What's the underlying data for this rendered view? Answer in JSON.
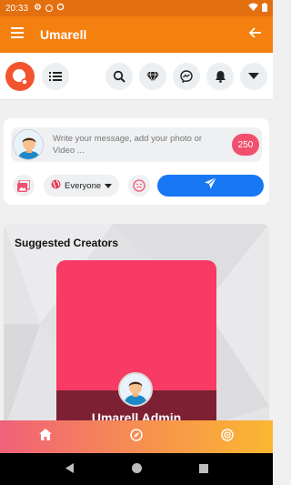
{
  "status_bar": {
    "time": "20:33",
    "left_icons": [
      "settings-icon",
      "circle-app-icon",
      "sync-icon"
    ],
    "right_icons": [
      "wifi-icon",
      "battery-icon"
    ]
  },
  "app_bar": {
    "title": "Umarell",
    "menu_icon": "hamburger-menu-icon",
    "back_icon": "arrow-back-icon",
    "color": "#f4800f"
  },
  "top_nav": {
    "logo": "app-logo",
    "buttons": [
      "list-icon",
      "search-icon",
      "diamond-icon",
      "messenger-icon",
      "bell-icon",
      "caret-down-icon"
    ]
  },
  "composer": {
    "placeholder": "Write your message, add your photo or Video ...",
    "char_count": "250",
    "audience": "Everyone",
    "actions": [
      "gallery-icon",
      "globe-icon",
      "emoji-icon",
      "send-icon"
    ],
    "send_color": "#1877f2"
  },
  "suggested": {
    "heading": "Suggested Creators",
    "creator": {
      "name": "Umarell Admin",
      "card_color": "#f73b64"
    }
  },
  "bottom_nav": {
    "items": [
      "home-icon",
      "explore-icon",
      "live-icon"
    ]
  },
  "system_nav": {
    "items": [
      "back-triangle-icon",
      "home-circle-icon",
      "recents-square-icon"
    ]
  }
}
